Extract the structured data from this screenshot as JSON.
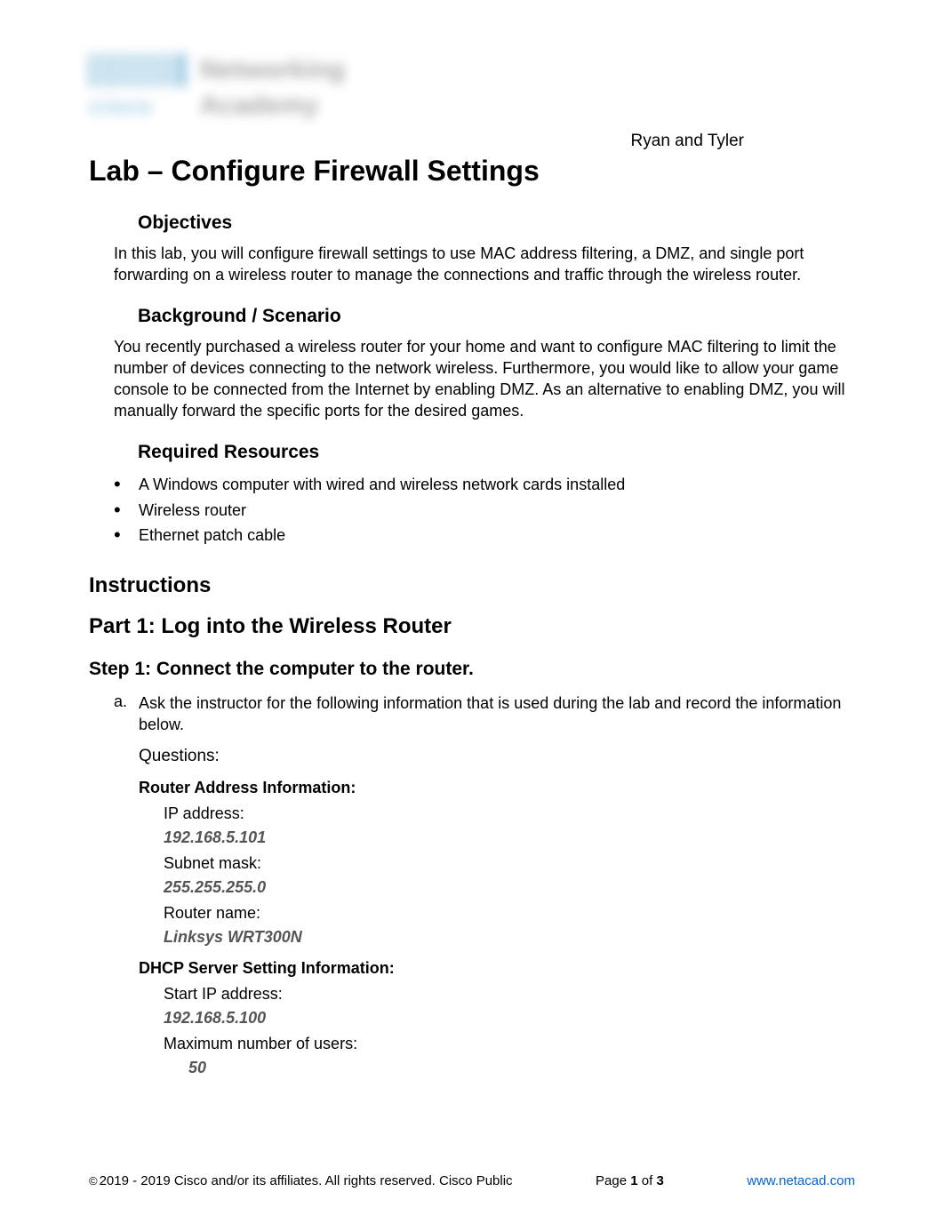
{
  "header": {
    "logo_line1": "Networking",
    "logo_line2": "Academy",
    "logo_brand": "cisco",
    "authors": "Ryan and Tyler"
  },
  "title": "Lab – Configure Firewall Settings",
  "sections": {
    "objectives": {
      "heading": "Objectives",
      "text": "In this lab, you will configure firewall settings to use MAC address filtering, a DMZ, and single port forwarding on a wireless router to manage the connections and traffic through the wireless router."
    },
    "background": {
      "heading": "Background / Scenario",
      "text": "You recently purchased a wireless router for your home and want to configure MAC filtering to limit the number of devices connecting to the network wireless. Furthermore, you would like to allow your game console to be connected from the Internet by enabling DMZ. As an alternative to enabling DMZ, you will manually forward the specific ports for the desired games."
    },
    "resources": {
      "heading": "Required Resources",
      "items": [
        "A Windows computer with wired and wireless network cards installed",
        "Wireless router",
        "Ethernet patch cable"
      ]
    }
  },
  "instructions_heading": "Instructions",
  "part1": {
    "heading": "Part 1: Log into the Wireless Router",
    "step1": {
      "heading": "Step 1: Connect the computer to the router.",
      "item_a": {
        "letter": "a.",
        "text": "Ask the instructor for the following information that is used during the lab and record the information below."
      },
      "questions_label": "Questions:",
      "router_info": {
        "heading": "Router Address Information:",
        "ip_label": "IP address:",
        "ip_value": "192.168.5.101",
        "subnet_label": "Subnet mask:",
        "subnet_value": "255.255.255.0",
        "name_label": "Router name:",
        "name_value": "Linksys WRT300N"
      },
      "dhcp_info": {
        "heading": "DHCP Server Setting Information:",
        "start_ip_label": "Start IP address:",
        "start_ip_value": "192.168.5.100",
        "max_users_label": "Maximum number of users:",
        "max_users_value": "50"
      }
    }
  },
  "footer": {
    "copyright": "2019 - 2019 Cisco and/or its affiliates. All rights reserved. Cisco Public",
    "page_label_pre": "Page ",
    "page_current": "1",
    "page_label_mid": " of ",
    "page_total": "3",
    "link": "www.netacad.com"
  }
}
